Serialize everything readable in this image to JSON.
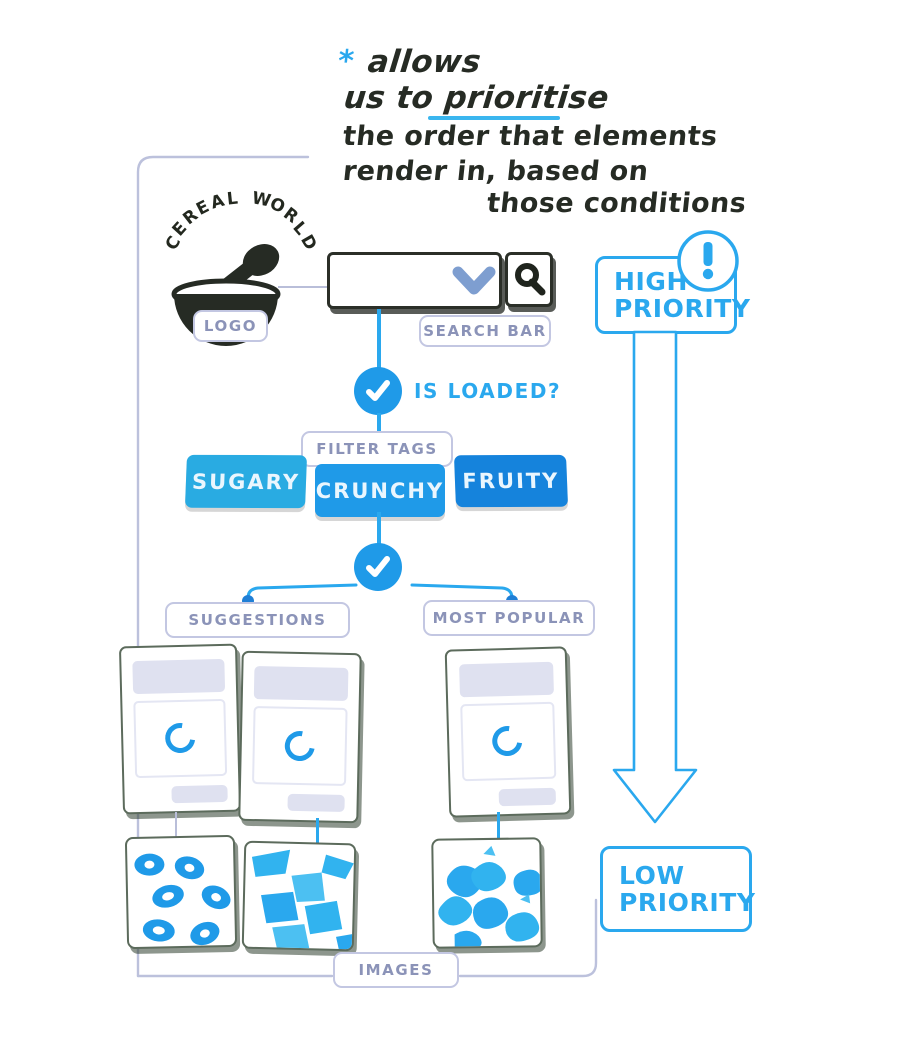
{
  "annotation": {
    "bullet": "*",
    "lines": [
      "allows",
      "us to prioritise",
      "the order that elements",
      "render in, based on",
      "those conditions"
    ],
    "emphasis_word": "prioritise"
  },
  "brand": {
    "name": "CEREAL WORLD",
    "letters": [
      "C",
      "E",
      "R",
      "E",
      "A",
      "L",
      "W",
      "O",
      "R",
      "L",
      "D"
    ],
    "logo_label": "LOGO",
    "logo_icon": "cereal-bowl-with-spoon-icon"
  },
  "search": {
    "label": "SEARCH BAR",
    "value": "",
    "placeholder": "",
    "dropdown_icon": "chevron-down-icon",
    "submit_icon": "magnifier-icon"
  },
  "conditions": [
    {
      "id": "is-loaded",
      "label": "IS LOADED?",
      "icon": "check-circle-icon",
      "state": "checked"
    },
    {
      "id": "branch-check",
      "label": "",
      "icon": "check-circle-icon",
      "state": "checked"
    }
  ],
  "filters": {
    "label": "FILTER TAGS",
    "tags": [
      {
        "label": "SUGARY",
        "color": "#29abe2"
      },
      {
        "label": "CRUNCHY",
        "color": "#1f9ae8"
      },
      {
        "label": "FRUITY",
        "color": "#1583dc"
      }
    ]
  },
  "sections": [
    {
      "label": "SUGGESTIONS"
    },
    {
      "label": "MOST POPULAR"
    }
  ],
  "results": {
    "skeleton_cards": [
      {
        "id": "card-1",
        "state": "loading",
        "spinner_icon": "loading-spinner-icon"
      },
      {
        "id": "card-2",
        "state": "loading",
        "spinner_icon": "loading-spinner-icon"
      },
      {
        "id": "card-3",
        "state": "loading",
        "spinner_icon": "loading-spinner-icon"
      }
    ],
    "images_label": "IMAGES",
    "image_cards": [
      {
        "id": "image-1",
        "motif": "cereal-rings"
      },
      {
        "id": "image-2",
        "motif": "cereal-flakes"
      },
      {
        "id": "image-3",
        "motif": "cereal-clusters"
      }
    ]
  },
  "priority": {
    "high": {
      "line1": "HIGH",
      "line2": "PRIORITY",
      "icon": "exclamation-circle-icon"
    },
    "low": {
      "line1": "LOW",
      "line2": "PRIORITY"
    },
    "arrow_icon": "long-down-arrow-icon",
    "accent_color": "#2aa8ee"
  }
}
